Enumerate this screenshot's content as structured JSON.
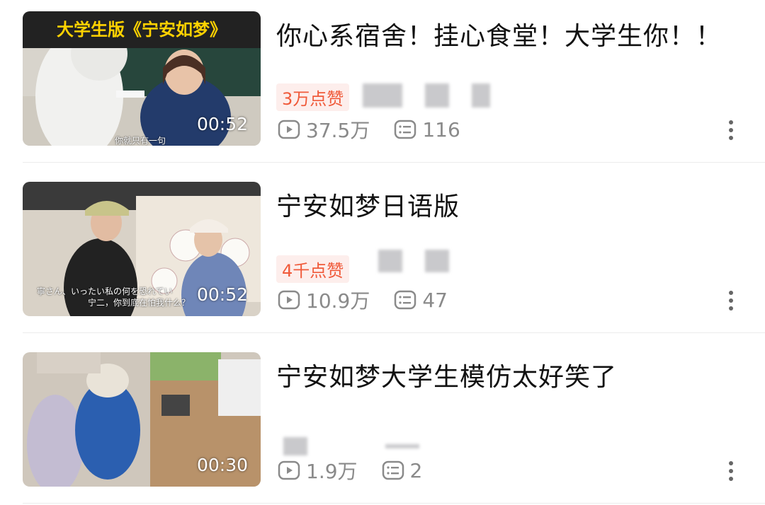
{
  "videos": [
    {
      "title": "你心系宿舍！挂心食堂！大学生你！！",
      "likes": "3万点赞",
      "views": "37.5万",
      "comments": "116",
      "duration": "00:52",
      "thumb_banner": "大学生版《宁安如梦》",
      "thumb_subtitle": "你就只有一句"
    },
    {
      "title": "宁安如梦日语版",
      "likes": "4千点赞",
      "views": "10.9万",
      "comments": "47",
      "duration": "00:52",
      "thumb_subtitle_jp": "寧さん、いったい私の何を恐れてい",
      "thumb_subtitle_cn": "宁二，你到底在怕我什么？"
    },
    {
      "title": "宁安如梦大学生模仿太好笑了",
      "views": "1.9万",
      "comments": "2",
      "duration": "00:30"
    }
  ],
  "icons": {
    "views": "play-box-icon",
    "comments": "comment-list-icon",
    "more": "more-vertical-icon"
  },
  "colors": {
    "likes_text": "#f05a3a",
    "likes_bg": "#fdeeec",
    "stat_text": "#8a8a8a",
    "title_text": "#111111"
  }
}
